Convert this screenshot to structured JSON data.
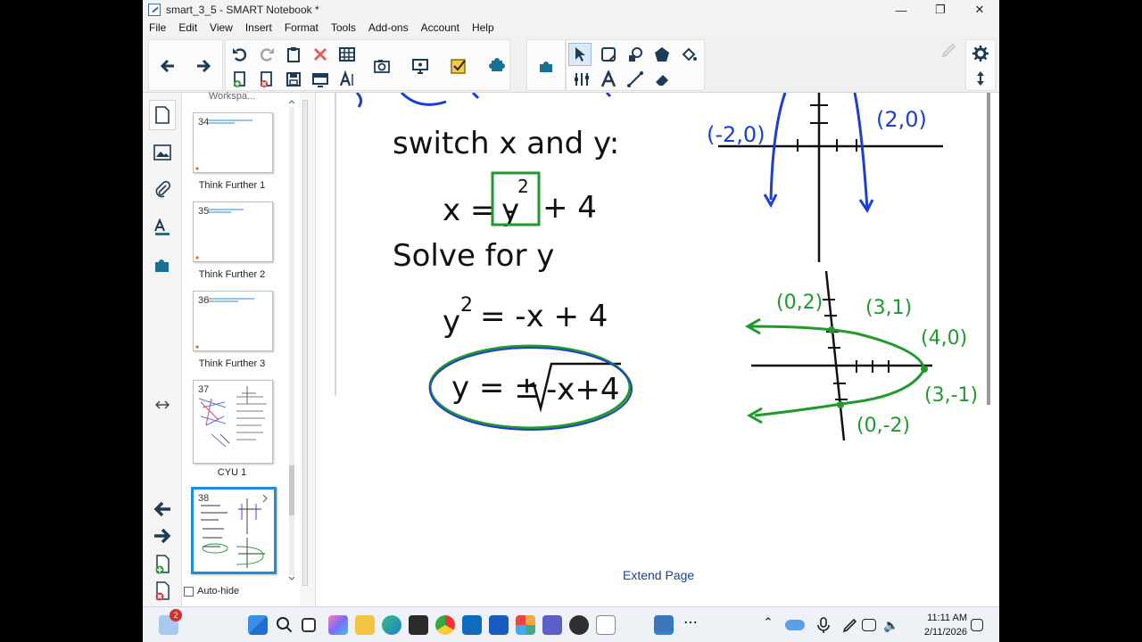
{
  "window": {
    "title": "smart_3_5 - SMART Notebook *",
    "minimize_glyph": "—",
    "restore_glyph": "❐",
    "close_glyph": "✕"
  },
  "menu": [
    "File",
    "Edit",
    "View",
    "Insert",
    "Format",
    "Tools",
    "Add-ons",
    "Account",
    "Help"
  ],
  "sorter": {
    "partial_label": "Workspa...",
    "pages": [
      {
        "num": "34",
        "label": "Think Further 1"
      },
      {
        "num": "35",
        "label": "Think Further 2"
      },
      {
        "num": "36",
        "label": "Think Further 3"
      },
      {
        "num": "37",
        "label": "CYU 1"
      },
      {
        "num": "38",
        "label": ""
      }
    ],
    "autohide_label": "Auto-hide"
  },
  "notes": {
    "step1": "switch x and y:",
    "eq1_x": "x = -",
    "eq1_y": "y",
    "eq1_exp": "2",
    "eq1_rest": "+ 4",
    "step2": "Solve for y",
    "eq2_left": "y",
    "eq2_exp": "2",
    "eq2_right": "= -x + 4",
    "eq3_left": "y = ±",
    "eq3_radicand": "-x+4",
    "graph1_left_point": "(-2,0)",
    "graph1_right_point": "(2,0)",
    "graph2_points": [
      "(0,2)",
      "(3,1)",
      "(4,0)",
      "(3,-1)",
      "(0,-2)"
    ]
  },
  "extend_page": "Extend Page",
  "taskbar": {
    "notification_count": "2",
    "time": "11:11 AM",
    "date": "2/11/2026"
  },
  "colors": {
    "ink_black": "#111111",
    "ink_green": "#1f9a2b",
    "ink_blue": "#1c3fd1",
    "accent": "#1e8fd6"
  }
}
